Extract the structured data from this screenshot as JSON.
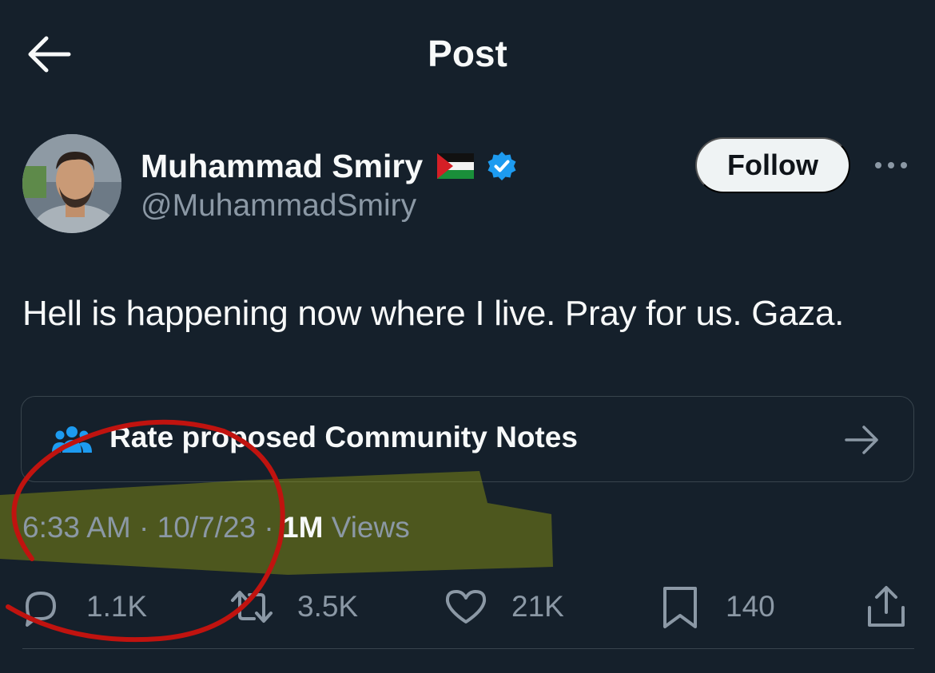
{
  "header": {
    "title": "Post",
    "back_icon": "arrow-left-icon"
  },
  "author": {
    "display_name": "Muhammad Smiry",
    "handle": "@MuhammadSmiry",
    "flag_icon": "palestine-flag-icon",
    "verified_icon": "verified-badge-icon",
    "verified_color": "#1d9bf0"
  },
  "follow_label": "Follow",
  "post": {
    "text": "Hell is happening now where I live. Pray for us. Gaza."
  },
  "community_notes": {
    "label": "Rate proposed Community Notes",
    "icon": "people-icon",
    "icon_color": "#1d9bf0"
  },
  "meta": {
    "time": "6:33 AM",
    "date": "10/7/23",
    "views_count": "1M",
    "views_label": "Views"
  },
  "actions": {
    "replies": "1.1K",
    "retweets": "3.5K",
    "likes": "21K",
    "bookmarks": "140"
  },
  "annotation": {
    "highlight_color": "#a8b40a",
    "circle_color": "#c0130f"
  }
}
